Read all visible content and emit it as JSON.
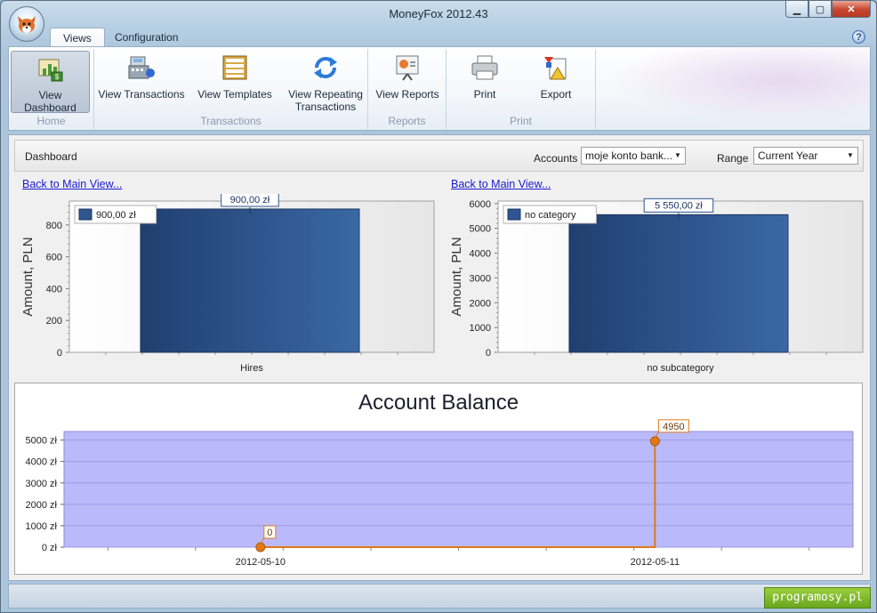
{
  "window": {
    "title": "MoneyFox 2012.43"
  },
  "ribbon": {
    "tabs": [
      {
        "label": "Views"
      },
      {
        "label": "Configuration"
      }
    ],
    "groups": [
      {
        "label": "Home",
        "buttons": [
          {
            "label": "View Dashboard",
            "icon": "dashboard-icon"
          }
        ]
      },
      {
        "label": "Transactions",
        "buttons": [
          {
            "label": "View Transactions",
            "icon": "cash-register-icon"
          },
          {
            "label": "View Templates",
            "icon": "templates-icon"
          },
          {
            "label": "View Repeating Transactions",
            "icon": "repeat-icon"
          }
        ]
      },
      {
        "label": "Reports",
        "buttons": [
          {
            "label": "View Reports",
            "icon": "reports-icon"
          }
        ]
      },
      {
        "label": "Print",
        "buttons": [
          {
            "label": "Print",
            "icon": "printer-icon"
          },
          {
            "label": "Export",
            "icon": "export-icon"
          }
        ]
      }
    ]
  },
  "dashboard": {
    "title": "Dashboard",
    "accounts_label": "Accounts",
    "accounts_value": "moje konto bank...",
    "range_label": "Range",
    "range_value": "Current Year",
    "back_link": "Back to Main View..."
  },
  "chart_data": [
    {
      "type": "bar",
      "categories": [
        "Hires"
      ],
      "series": [
        {
          "name": "900,00 zł",
          "values": [
            900
          ]
        }
      ],
      "data_labels": [
        "900,00 zł"
      ],
      "ylabel": "Amount, PLN",
      "ylim": [
        0,
        950
      ],
      "yticks": [
        0,
        200,
        400,
        600,
        800
      ],
      "legend": "top-left",
      "color": "#2f5590"
    },
    {
      "type": "bar",
      "categories": [
        "no subcategory"
      ],
      "series": [
        {
          "name": "no category",
          "values": [
            5550
          ]
        }
      ],
      "data_labels": [
        "5 550,00 zł"
      ],
      "ylabel": "Amount, PLN",
      "ylim": [
        0,
        6100
      ],
      "yticks": [
        0,
        1000,
        2000,
        3000,
        4000,
        5000,
        6000
      ],
      "legend": "top-left",
      "color": "#2f5590"
    },
    {
      "type": "area",
      "title": "Account Balance",
      "x": [
        "2012-05-10",
        "2012-05-11"
      ],
      "values": [
        0,
        4950
      ],
      "data_labels": [
        "0",
        "4950"
      ],
      "yticks": [
        "0 zł",
        "1000 zł",
        "2000 zł",
        "3000 zł",
        "4000 zł",
        "5000 zł"
      ],
      "ylim": [
        0,
        5400
      ],
      "line_color": "#e07818",
      "fill_color": "#babafa"
    }
  ],
  "watermark": "programosy.pl"
}
